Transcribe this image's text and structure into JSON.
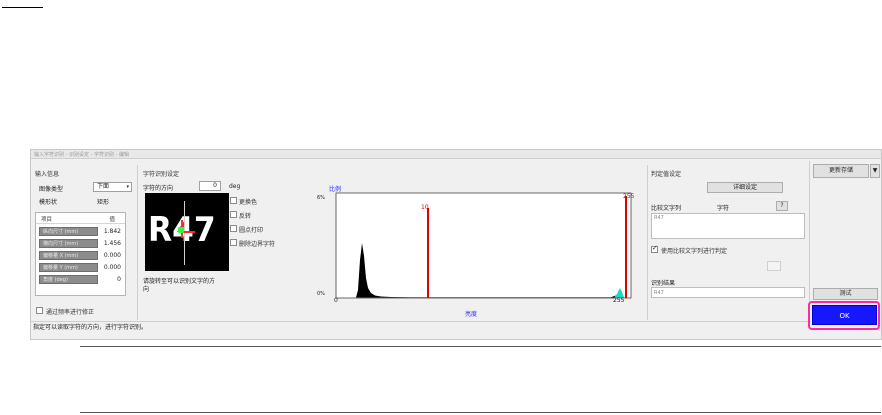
{
  "window_title": "输入字符识别 - 识别设定 - 字符识别 - 编辑",
  "input_info": {
    "section_title": "输入信息",
    "image_type_label": "图像类型",
    "image_type_value": "下面",
    "shape_label": "模形状",
    "shape_value": "矩形",
    "table_header_item": "项目",
    "table_header_value": "值",
    "params": [
      {
        "label": "纵向尺寸 (mm)",
        "value": "1.842"
      },
      {
        "label": "横向尺寸 (mm)",
        "value": "1.456"
      },
      {
        "label": "偏移量 X (mm)",
        "value": "0.000"
      },
      {
        "label": "偏移量 Y (mm)",
        "value": "0.000"
      },
      {
        "label": "角度 (deg)",
        "value": "0"
      }
    ],
    "skew_correction_label": "通过频率进行修正"
  },
  "char_settings": {
    "section_title": "字符识别设定",
    "direction_label": "字符的方向",
    "direction_value": "0",
    "direction_unit": "deg",
    "options": [
      {
        "label": "更换色",
        "checked": false
      },
      {
        "label": "反转",
        "checked": false
      },
      {
        "label": "圆点打印",
        "checked": false
      },
      {
        "label": "删除边界字符",
        "checked": false
      }
    ],
    "preview_text": "R47",
    "hint_text_line1": "请旋转至可以识别文字的方",
    "hint_text_line2": "向"
  },
  "histogram": {
    "y_title": "比例",
    "y_top": "6%",
    "y_bottom": "0%",
    "x_min": "0",
    "x_max": "255",
    "x_title": "亮度",
    "marker_left": "10",
    "marker_right": "255"
  },
  "judge_settings": {
    "section_title": "判定值设定",
    "detail_button": "详细设定",
    "compare_label": "比较文字列",
    "compare_mode": "字符",
    "compare_help": "?",
    "compare_value": "R47",
    "use_compare_label": "使用比较文字列进行判定",
    "use_compare_checked": true,
    "result_label": "识别结果",
    "result_value": "R47"
  },
  "right_panel": {
    "save_dropdown": "更新存储",
    "test_button": "测试",
    "ok_button": "OK"
  },
  "status_text": "指定可以读取字符的方向，进行字符识别。",
  "colors": {
    "ok_fill": "#1717ff",
    "ok_highlight": "#ff2aa0",
    "marker": "#e00000",
    "accent_text": "#2b2bff"
  }
}
